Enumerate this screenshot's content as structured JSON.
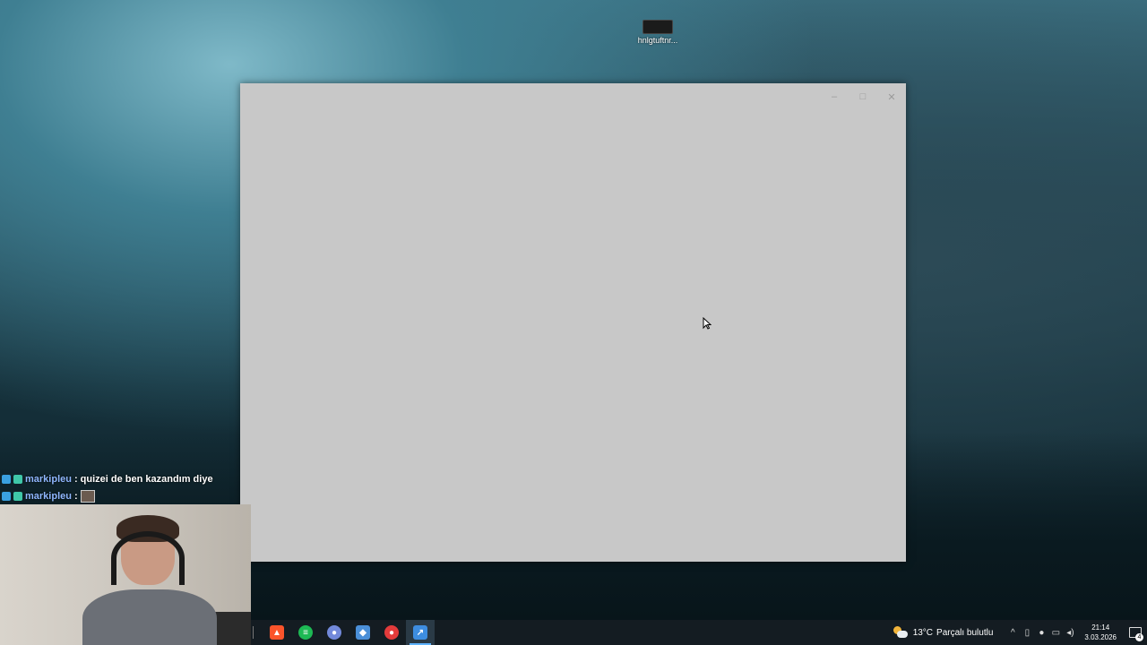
{
  "desktop": {
    "icon_label": "hnlgtuftnr..."
  },
  "window": {
    "controls": {
      "minimize_glyph": "–",
      "maximize_glyph": "□",
      "close_glyph": "✕"
    }
  },
  "chat": {
    "messages": [
      {
        "user": "markipleu",
        "separator": ":",
        "text": "quizei de ben kazandım diye"
      },
      {
        "user": "markipleu",
        "separator": ":",
        "text": ""
      }
    ]
  },
  "taskbar": {
    "apps": [
      {
        "name": "brave",
        "glyph": "▲",
        "color": "#fb542b"
      },
      {
        "name": "spotify",
        "glyph": "≡",
        "color": "#1db954"
      },
      {
        "name": "discord",
        "glyph": "●",
        "color": "#7289da"
      },
      {
        "name": "app-blue",
        "glyph": "◆",
        "color": "#4a8fd8"
      },
      {
        "name": "app-red",
        "glyph": "●",
        "color": "#e33b3b"
      },
      {
        "name": "app-active",
        "glyph": "↗",
        "color": "#3d8de0",
        "active": true
      }
    ],
    "weather": {
      "temperature": "13°C",
      "condition": "Parçalı bulutlu"
    },
    "clock": {
      "time": "21:14",
      "date": "3.03.2026"
    },
    "notification_count": "4"
  }
}
